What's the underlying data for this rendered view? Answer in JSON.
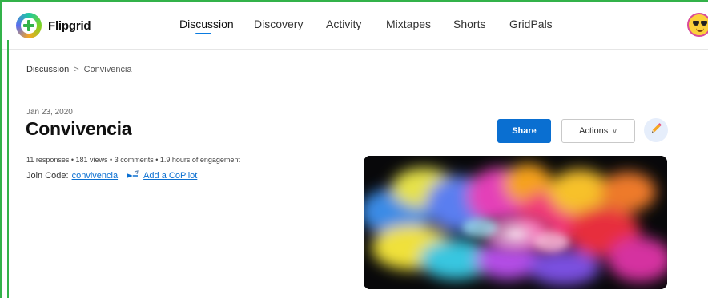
{
  "app": {
    "name": "Flipgrid"
  },
  "nav": {
    "items": [
      {
        "label": "Discussion",
        "active": true
      },
      {
        "label": "Discovery",
        "active": false
      },
      {
        "label": "Activity",
        "active": false
      },
      {
        "label": "Mixtapes",
        "active": false
      },
      {
        "label": "Shorts",
        "active": false
      },
      {
        "label": "GridPals",
        "active": false
      }
    ]
  },
  "user": {
    "avatar_icon": "sunglasses-emoji-avatar"
  },
  "breadcrumb": {
    "root": "Discussion",
    "separator": ">",
    "current": "Convivencia"
  },
  "topic": {
    "date": "Jan 23, 2020",
    "title": "Convivencia",
    "stats": "11 responses • 181 views • 3 comments • 1.9 hours of engagement",
    "join_code_label": "Join Code:",
    "join_code": "convivencia",
    "copilot_link": "Add a CoPilot"
  },
  "actions": {
    "share_label": "Share",
    "actions_label": "Actions",
    "edit_icon": "pencil-icon"
  },
  "hero_image": {
    "description_icon": "color-powder-explosion"
  },
  "colors": {
    "accent": "#0a6fd1",
    "frame": "#33b24a",
    "brand_green": "#33b24a"
  }
}
